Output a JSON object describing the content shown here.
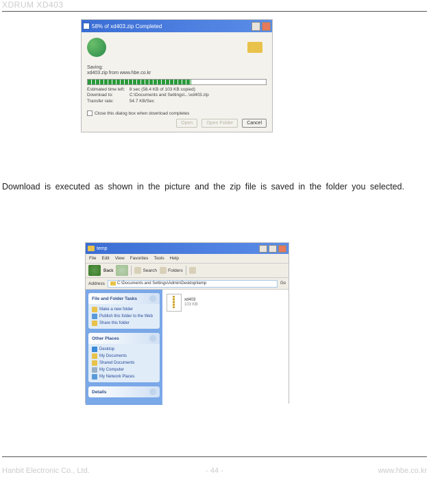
{
  "header": {
    "title": "XDRUM XD403"
  },
  "download_dialog": {
    "title": "58% of xd403.zip Completed",
    "saving_label": "Saving:",
    "filename": "xd403.zip from www.hbe.co.kr",
    "info": {
      "time_label": "Estimated time left:",
      "time_value": "8 sec (58.4 KB of 103 KB copied)",
      "dest_label": "Download to:",
      "dest_value": "C:\\Documents and Settings\\...\\xd403.zip",
      "rate_label": "Transfer rate:",
      "rate_value": "54.7 KB/Sec"
    },
    "checkbox_label": "Close this dialog box when download completes",
    "buttons": {
      "open": "Open",
      "openfolder": "Open Folder",
      "cancel": "Cancel"
    }
  },
  "body_text": "Download is executed as shown in the picture and the zip file is saved in the folder you selected.",
  "explorer": {
    "title": "temp",
    "menu": {
      "file": "File",
      "edit": "Edit",
      "view": "View",
      "favorites": "Favorites",
      "tools": "Tools",
      "help": "Help"
    },
    "toolbar": {
      "back": "Back",
      "search": "Search",
      "folders": "Folders"
    },
    "address_label": "Address",
    "address_value": "C:\\Documents and Settings\\Admin\\Desktop\\temp",
    "go_label": "Go",
    "panels": {
      "tasks_title": "File and Folder Tasks",
      "tasks_items": [
        "Make a new folder",
        "Publish this folder to the Web",
        "Share this folder"
      ],
      "places_title": "Other Places",
      "places_items": [
        "Desktop",
        "My Documents",
        "Shared Documents",
        "My Computer",
        "My Network Places"
      ],
      "details_title": "Details"
    },
    "file": {
      "name": "xd403",
      "size": "103 KB"
    }
  },
  "footer": {
    "left": "Hanbit Electronic Co., Ltd.",
    "center": "- 44 -",
    "right": "www.hbe.co.kr"
  }
}
